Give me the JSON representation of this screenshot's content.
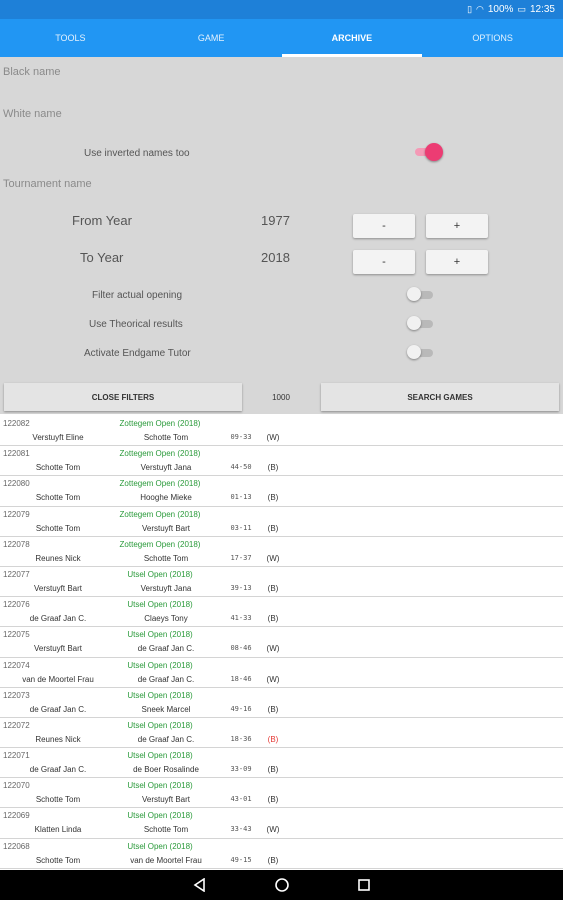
{
  "status": {
    "battery": "100%",
    "time": "12:35"
  },
  "tabs": [
    {
      "label": "TOOLS",
      "active": false
    },
    {
      "label": "GAME",
      "active": false
    },
    {
      "label": "ARCHIVE",
      "active": true
    },
    {
      "label": "OPTIONS",
      "active": false
    }
  ],
  "filters": {
    "black_name_label": "Black name",
    "white_name_label": "White name",
    "inverted_label": "Use inverted names too",
    "inverted_on": true,
    "tournament_label": "Tournament name",
    "from_year_label": "From Year",
    "from_year_value": "1977",
    "to_year_label": "To Year",
    "to_year_value": "2018",
    "minus_label": "-",
    "plus_label": "+",
    "opening_label": "Filter actual opening",
    "opening_on": false,
    "theoretical_label": "Use Theorical results",
    "theoretical_on": false,
    "endgame_label": "Activate Endgame Tutor",
    "endgame_on": false,
    "close_filters_label": "CLOSE FILTERS",
    "max_games": "1000",
    "search_label": "SEARCH GAMES"
  },
  "games": [
    {
      "id": "122082",
      "tournament": "Zottegem Open (2018)",
      "white": "Verstuyft Eline",
      "black": "Schotte Tom",
      "moves": "09-33",
      "result": "(W)",
      "result_color": "normal"
    },
    {
      "id": "122081",
      "tournament": "Zottegem Open (2018)",
      "white": "Schotte Tom",
      "black": "Verstuyft Jana",
      "moves": "44-50",
      "result": "(B)",
      "result_color": "normal"
    },
    {
      "id": "122080",
      "tournament": "Zottegem Open (2018)",
      "white": "Schotte Tom",
      "black": "Hooghe Mieke",
      "moves": "01-13",
      "result": "(B)",
      "result_color": "normal"
    },
    {
      "id": "122079",
      "tournament": "Zottegem Open (2018)",
      "white": "Schotte Tom",
      "black": "Verstuyft Bart",
      "moves": "03-11",
      "result": "(B)",
      "result_color": "normal"
    },
    {
      "id": "122078",
      "tournament": "Zottegem Open (2018)",
      "white": "Reunes Nick",
      "black": "Schotte Tom",
      "moves": "17-37",
      "result": "(W)",
      "result_color": "normal"
    },
    {
      "id": "122077",
      "tournament": "Utsel Open (2018)",
      "white": "Verstuyft Bart",
      "black": "Verstuyft Jana",
      "moves": "39-13",
      "result": "(B)",
      "result_color": "normal"
    },
    {
      "id": "122076",
      "tournament": "Utsel Open (2018)",
      "white": "de Graaf Jan C.",
      "black": "Claeys Tony",
      "moves": "41-33",
      "result": "(B)",
      "result_color": "normal"
    },
    {
      "id": "122075",
      "tournament": "Utsel Open (2018)",
      "white": "Verstuyft Bart",
      "black": "de Graaf Jan C.",
      "moves": "08-46",
      "result": "(W)",
      "result_color": "normal"
    },
    {
      "id": "122074",
      "tournament": "Utsel Open (2018)",
      "white": "van de Moortel Frau",
      "black": "de Graaf Jan C.",
      "moves": "18-46",
      "result": "(W)",
      "result_color": "normal"
    },
    {
      "id": "122073",
      "tournament": "Utsel Open (2018)",
      "white": "de Graaf Jan C.",
      "black": "Sneek Marcel",
      "moves": "49-16",
      "result": "(B)",
      "result_color": "normal"
    },
    {
      "id": "122072",
      "tournament": "Utsel Open (2018)",
      "white": "Reunes Nick",
      "black": "de Graaf Jan C.",
      "moves": "18-36",
      "result": "(B)",
      "result_color": "red"
    },
    {
      "id": "122071",
      "tournament": "Utsel Open (2018)",
      "white": "de Graaf Jan C.",
      "black": "de Boer Rosalinde",
      "moves": "33-09",
      "result": "(B)",
      "result_color": "normal"
    },
    {
      "id": "122070",
      "tournament": "Utsel Open (2018)",
      "white": "Schotte Tom",
      "black": "Verstuyft Bart",
      "moves": "43-01",
      "result": "(B)",
      "result_color": "normal"
    },
    {
      "id": "122069",
      "tournament": "Utsel Open (2018)",
      "white": "Klatten Linda",
      "black": "Schotte Tom",
      "moves": "33-43",
      "result": "(W)",
      "result_color": "normal"
    },
    {
      "id": "122068",
      "tournament": "Utsel Open (2018)",
      "white": "Schotte Tom",
      "black": "van de Moortel Frau",
      "moves": "49-15",
      "result": "(B)",
      "result_color": "normal"
    }
  ],
  "colors": {
    "statusbar": "#1e80d8",
    "tabbar": "#2196f3",
    "filter_bg": "#d7d7d7",
    "tournament_text": "#2a9a3a",
    "toggle_on": "#ec3c73",
    "result_red": "#e53935"
  },
  "nav": {
    "back_icon": "back-triangle-icon",
    "home_icon": "home-circle-icon",
    "recents_icon": "recents-square-icon"
  }
}
